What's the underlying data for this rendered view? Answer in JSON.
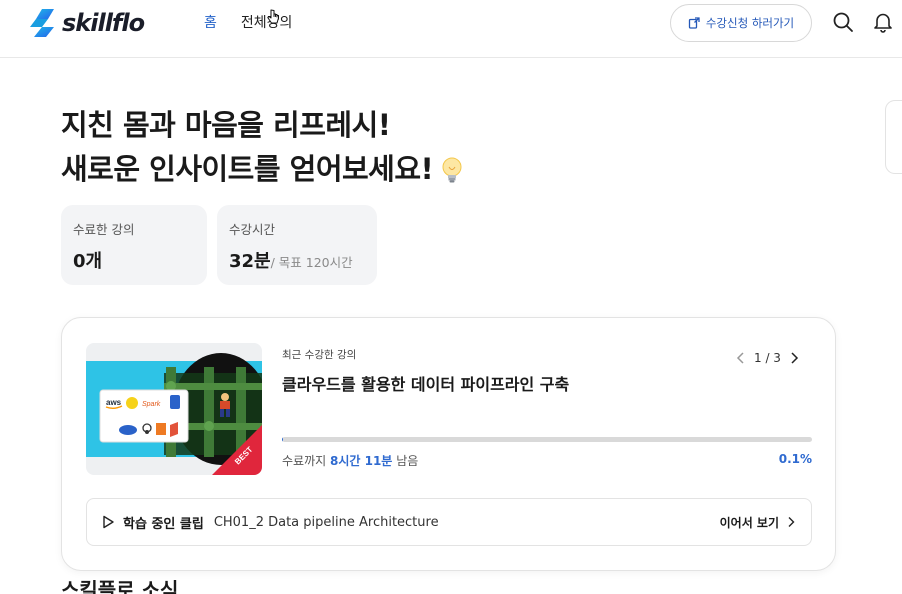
{
  "header": {
    "logo_text": "skillflo",
    "nav": [
      {
        "label": "홈",
        "active": true
      },
      {
        "label": "전체강의",
        "active": false
      }
    ],
    "enroll_button": "수강신청 하러가기"
  },
  "hero": {
    "line1": "지친 몸과 마음을 리프레시!",
    "line2": "새로운 인사이트를 얻어보세요!"
  },
  "stats": {
    "completed": {
      "label": "수료한 강의",
      "value": "0개"
    },
    "study_time": {
      "label": "수강시간",
      "value": "32분",
      "goal": "/ 목표 120시간"
    }
  },
  "course": {
    "recent_label": "최근 수강한 강의",
    "title": "클라우드를 활용한 데이터 파이프라인 구축",
    "pager": "1 / 3",
    "remain_prefix": "수료까지",
    "remain_time": "8시간 11분",
    "remain_suffix": "남음",
    "progress": 0.001,
    "percent_text": "0.1%",
    "thumb_badge": "BEST",
    "thumb_logos": [
      "aws",
      "Spark"
    ],
    "clip_label": "학습 중인 클립",
    "clip_name": "CH01_2 Data pipeline Architecture",
    "continue_label": "이어서 보기"
  },
  "news_title": "스킬플로 소식",
  "colors": {
    "accent": "#2f6ad0",
    "nav_active": "#2563c9",
    "stat_bg": "#f3f4f6",
    "badge_red": "#e0263c"
  }
}
